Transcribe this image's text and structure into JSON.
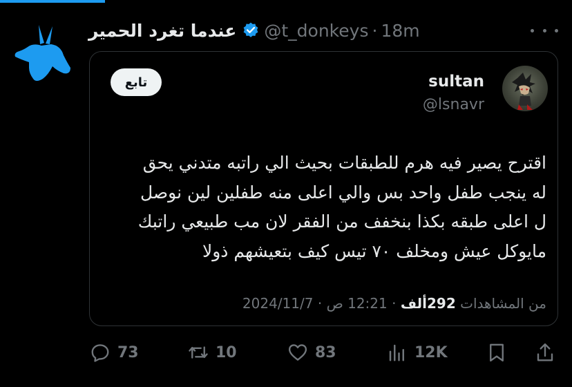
{
  "tweet": {
    "display_name": "عندما تغرد الحمير",
    "handle": "@t_donkeys",
    "separator": "·",
    "time": "18m",
    "verified": true
  },
  "quoted": {
    "follow_label": "تابع",
    "name": "sultan",
    "handle": "@lsnavr",
    "lines": [
      "اقترح يصير فيه هرم للطبقات بحيث الي راتبه متدني يحق",
      "له ينجب طفل واحد بس والي اعلى منه طفلين لين نوصل",
      "ل اعلى طبقه بكذا بنخفف من الفقر  لان مب طبيعي راتبك",
      "مايوكل عيش ومخلف ٧٠ تيس كيف بتعيشهم ذولا"
    ],
    "meta": {
      "date": "2024/11/7",
      "time": "12:21 ص",
      "views_count": "292ألف",
      "views_label": "من المشاهدات"
    }
  },
  "actions": {
    "replies": "73",
    "reposts": "10",
    "likes": "83",
    "views": "12K"
  },
  "colors": {
    "accent": "#1d9bf0",
    "background": "#000000",
    "muted": "#71767b",
    "text": "#e7e9ea"
  }
}
